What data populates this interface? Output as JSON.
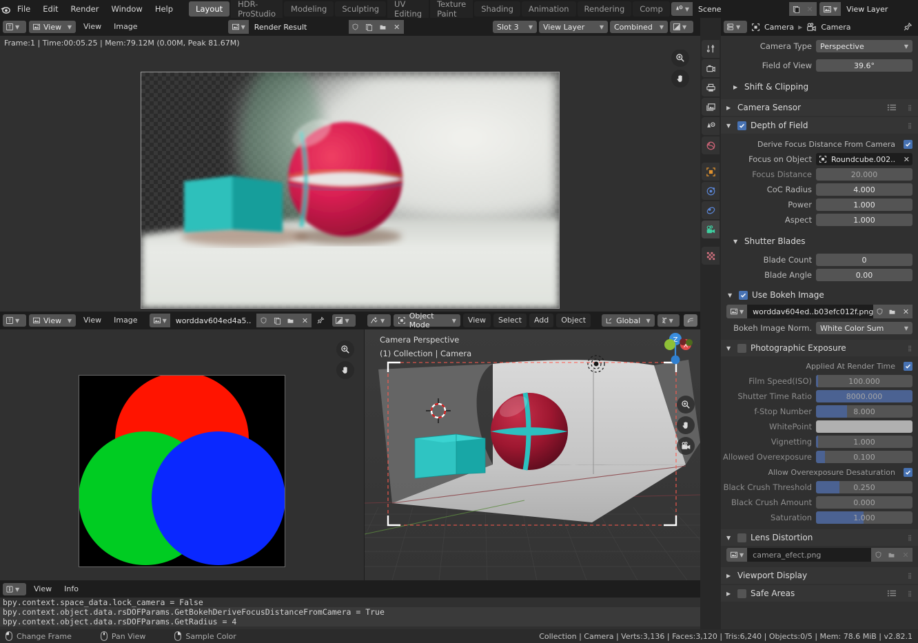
{
  "topbar": {
    "logo_icon": "blender-logo-icon",
    "menus": [
      "File",
      "Edit",
      "Render",
      "Window",
      "Help"
    ],
    "workspaces": [
      {
        "label": "Layout",
        "active": true
      },
      {
        "label": "HDR-ProStudio",
        "active": false
      },
      {
        "label": "Modeling",
        "active": false
      },
      {
        "label": "Sculpting",
        "active": false
      },
      {
        "label": "UV Editing",
        "active": false
      },
      {
        "label": "Texture Paint",
        "active": false
      },
      {
        "label": "Shading",
        "active": false
      },
      {
        "label": "Animation",
        "active": false
      },
      {
        "label": "Rendering",
        "active": false
      },
      {
        "label": "Comp",
        "active": false
      }
    ],
    "scene": {
      "name": "Scene",
      "icon": "scene-icon"
    },
    "view_layer": {
      "name": "View Layer",
      "icon": "view-layer-icon"
    }
  },
  "image_editor": {
    "editor_type_icon": "image-editor-icon",
    "mode_label": "View",
    "menus": [
      "View",
      "Image"
    ],
    "datablock": "Render Result",
    "slot": "Slot 3",
    "layer": "View Layer",
    "pass": "Combined",
    "display_icon": "display-channels-icon",
    "render_info": "Frame:1 | Time:00:05.25 | Mem:79.12M (0.00M, Peak 81.67M)"
  },
  "image_editor_2": {
    "editor_type_icon": "image-editor-icon",
    "mode_label": "View",
    "menus": [
      "View",
      "Image"
    ],
    "datablock": "worddav604ed4a5..",
    "image_alt": "RGB additive color wheel"
  },
  "viewport": {
    "mode": "Object Mode",
    "menus": [
      "View",
      "Select",
      "Add",
      "Object"
    ],
    "transform_orientation": "Global",
    "overlay_text_line1": "Camera Perspective",
    "overlay_text_line2": "(1) Collection | Camera",
    "axis_labels": {
      "z": "Z",
      "x": "X"
    }
  },
  "info_editor": {
    "editor_type_icon": "info-editor-icon",
    "menus": [
      "View",
      "Info"
    ],
    "lines": [
      "bpy.context.space_data.lock_camera = False",
      "bpy.context.object.data.rsDOFParams.GetBokehDeriveFocusDistanceFromCamera = True",
      "bpy.context.object.data.rsDOFParams.GetRadius = 4"
    ]
  },
  "properties": {
    "editor_icon": "properties-editor-icon",
    "breadcrumb": [
      {
        "label": "Camera",
        "icon": "object-icon"
      },
      {
        "label": "Camera",
        "icon": "camera-data-icon"
      }
    ],
    "pin_icon": "pin-icon",
    "tabs": [
      {
        "name": "tool",
        "icon": "tool-icon",
        "selected": false
      },
      {
        "name": "render",
        "icon": "render-icon",
        "selected": false
      },
      {
        "name": "output",
        "icon": "output-printer-icon",
        "selected": false
      },
      {
        "name": "view-layer",
        "icon": "view-layer-images-icon",
        "selected": false
      },
      {
        "name": "scene",
        "icon": "scene-cone-icon",
        "selected": false
      },
      {
        "name": "world",
        "icon": "world-globe-icon",
        "selected": false
      },
      {
        "name": "object",
        "icon": "object-square-icon",
        "selected": false
      },
      {
        "name": "modifiers",
        "icon": "physics-orbit-icon",
        "selected": false
      },
      {
        "name": "constraints",
        "icon": "constraint-icon",
        "selected": false
      },
      {
        "name": "camera-data",
        "icon": "camera-data-icon",
        "selected": true
      },
      {
        "name": "texture",
        "icon": "texture-checker-icon",
        "selected": false
      }
    ],
    "lens": {
      "camera_type_label": "Camera Type",
      "camera_type_value": "Perspective",
      "fov_label": "Field of View",
      "fov_value": "39.6°",
      "shift_clipping_label": "Shift & Clipping"
    },
    "camera_sensor_label": "Camera Sensor",
    "depth_of_field": {
      "title": "Depth of Field",
      "enabled": true,
      "derive_focus_label": "Derive Focus Distance From Camera",
      "derive_focus_checked": true,
      "focus_object_label": "Focus on Object",
      "focus_object_value": "Roundcube.002..",
      "focus_distance_label": "Focus Distance",
      "focus_distance_value": "20.000",
      "coc_radius_label": "CoC Radius",
      "coc_radius_value": "4.000",
      "power_label": "Power",
      "power_value": "1.000",
      "aspect_label": "Aspect",
      "aspect_value": "1.000"
    },
    "shutter_blades": {
      "title": "Shutter Blades",
      "blade_count_label": "Blade Count",
      "blade_count_value": "0",
      "blade_angle_label": "Blade Angle",
      "blade_angle_value": "0.00"
    },
    "bokeh": {
      "title": "Use Bokeh Image",
      "enabled": true,
      "image_name": "worddav604ed..b03efc012f.png",
      "norm_label": "Bokeh Image Norm.",
      "norm_value": "White Color Sum"
    },
    "exposure": {
      "title": "Photographic Exposure",
      "enabled": false,
      "rows": [
        {
          "label": "Applied At Render Time",
          "type": "checkbox",
          "checked": true
        },
        {
          "label": "Film Speed(ISO)",
          "type": "slider",
          "value": "100.000",
          "fill": 2
        },
        {
          "label": "Shutter Time Ratio",
          "type": "slider",
          "value": "8000.000",
          "fill": 100
        },
        {
          "label": "f-Stop Number",
          "type": "slider",
          "value": "8.000",
          "fill": 32
        },
        {
          "label": "WhitePoint",
          "type": "color",
          "color": "#b0b0b0"
        },
        {
          "label": "Vignetting",
          "type": "slider",
          "value": "1.000",
          "fill": 2
        },
        {
          "label": "Allowed Overexposure",
          "type": "slider",
          "value": "0.100",
          "fill": 9
        },
        {
          "label": "Allow Overexposure Desaturation",
          "type": "checkbox",
          "checked": true
        },
        {
          "label": "Black Crush Threshold",
          "type": "slider",
          "value": "0.250",
          "fill": 24
        },
        {
          "label": "Black Crush Amount",
          "type": "slider",
          "value": "0.000",
          "fill": 0
        },
        {
          "label": "Saturation",
          "type": "slider",
          "value": "1.000",
          "fill": 49
        }
      ]
    },
    "lens_distortion": {
      "title": "Lens Distortion",
      "enabled": false,
      "image_name": "camera_efect.png"
    },
    "viewport_display_label": "Viewport Display",
    "safe_areas_label": "Safe Areas"
  },
  "statusbar": {
    "hints": [
      {
        "icon": "mouse-left-icon",
        "label": "Change Frame"
      },
      {
        "icon": "mouse-middle-icon",
        "label": "Pan View"
      },
      {
        "icon": "mouse-right-icon",
        "label": "Sample Color"
      }
    ],
    "stats": "Collection | Camera | Verts:3,136 | Faces:3,120 | Tris:6,240 | Objects:0/5 | Mem: 78.6 MiB | v2.82.1"
  },
  "colors": {
    "accent_blue": "#4772b3",
    "slider_fill": "#4b6292",
    "panel_bg": "#303030",
    "header_bg": "#1d1d1d",
    "sphere_red": "#a31a32",
    "cube_teal": "#2bb5b5"
  }
}
